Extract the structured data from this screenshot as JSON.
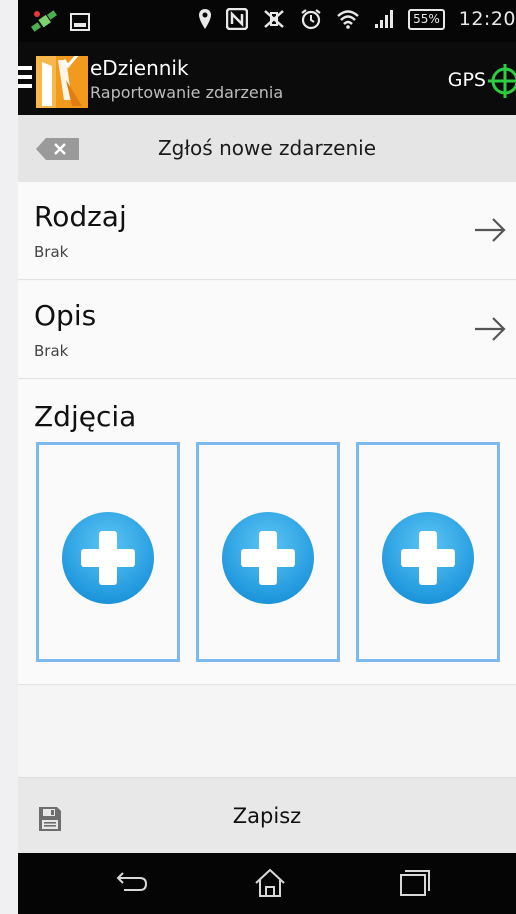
{
  "status_bar": {
    "battery": "55%",
    "time": "12:20"
  },
  "action_bar": {
    "app_name": "eDziennik",
    "subtitle": "Raportowanie zdarzenia",
    "gps_label": "GPS"
  },
  "form": {
    "title": "Zgłoś nowe zdarzenie",
    "fields": [
      {
        "label": "Rodzaj",
        "value": "Brak"
      },
      {
        "label": "Opis",
        "value": "Brak"
      }
    ],
    "photos_label": "Zdjęcia"
  },
  "footer": {
    "save_label": "Zapisz"
  },
  "icons": {
    "menu": "menu-icon",
    "gps": "crosshair-icon",
    "back_clear": "backspace-icon",
    "arrow": "arrow-right-icon",
    "add_photo": "plus-circle-icon",
    "save": "floppy-disk-icon",
    "nav_back": "back-arrow-icon",
    "nav_home": "home-icon",
    "nav_recent": "recent-apps-icon"
  },
  "colors": {
    "accent_blue": "#7db8ee",
    "gps_green": "#2ecc40",
    "add_button_blue": "#1ea0e6",
    "logo_orange": "#f29a1e"
  }
}
